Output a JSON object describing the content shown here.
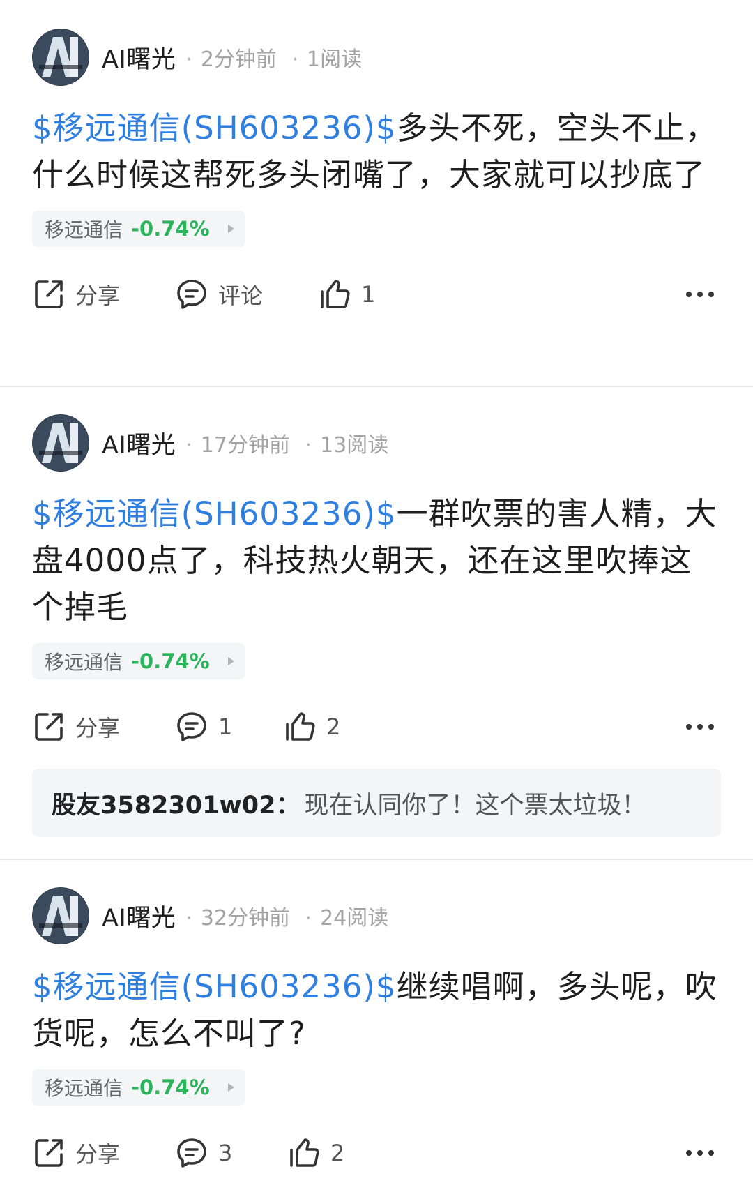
{
  "posts": [
    {
      "author": "AI曙光",
      "time": "2分钟前",
      "reads": "1阅读",
      "ticker_link": "$移远通信(SH603236)$",
      "text": "多头不死，空头不止，什么时候这帮死多头闭嘴了，大家就可以抄底了",
      "stock": {
        "name": "移远通信",
        "change": "-0.74%"
      },
      "actions": {
        "share": "分享",
        "comment": "评论",
        "like": "1"
      }
    },
    {
      "author": "AI曙光",
      "time": "17分钟前",
      "reads": "13阅读",
      "ticker_link": "$移远通信(SH603236)$",
      "text": "一群吹票的害人精，大盘4000点了，科技热火朝天，还在这里吹捧这个掉毛",
      "stock": {
        "name": "移远通信",
        "change": "-0.74%"
      },
      "actions": {
        "share": "分享",
        "comment": "1",
        "like": "2"
      },
      "reply": {
        "user": "股友3582301w02：",
        "text": "现在认同你了！这个票太垃圾！"
      }
    },
    {
      "author": "AI曙光",
      "time": "32分钟前",
      "reads": "24阅读",
      "ticker_link": "$移远通信(SH603236)$",
      "text": "继续唱啊，多头呢，吹货呢，怎么不叫了?",
      "stock": {
        "name": "移远通信",
        "change": "-0.74%"
      },
      "actions": {
        "share": "分享",
        "comment": "3",
        "like": "2"
      }
    }
  ],
  "colors": {
    "link": "#2f7fe0",
    "down": "#2db35c",
    "muted": "#a3a3a3"
  },
  "icons": [
    "share-icon",
    "comment-icon",
    "like-icon",
    "more-icon",
    "stock-arrow-icon"
  ]
}
